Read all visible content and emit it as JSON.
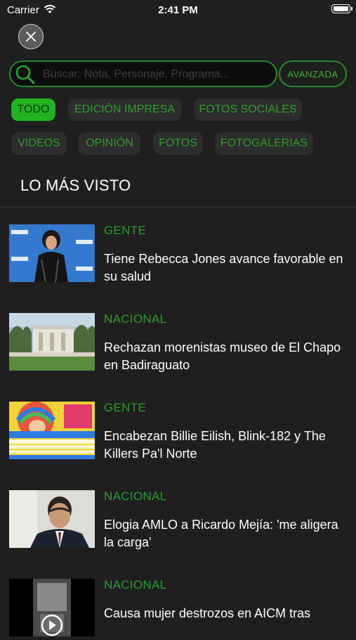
{
  "status_bar": {
    "carrier": "Carrier",
    "time": "2:41 PM"
  },
  "search": {
    "placeholder": "Buscar: Nota, Personaje, Programa...",
    "value": "",
    "advanced_label": "AVANZADA"
  },
  "filters": [
    {
      "label": "TODO",
      "active": true
    },
    {
      "label": "EDICIÓN IMPRESA",
      "active": false
    },
    {
      "label": "FOTOS SOCIALES",
      "active": false
    },
    {
      "label": "VIDEOS",
      "active": false
    },
    {
      "label": "OPINIÓN",
      "active": false
    },
    {
      "label": "FOTOS",
      "active": false
    },
    {
      "label": "FOTOGALERIAS",
      "active": false
    }
  ],
  "section_title": "LO MÁS VISTO",
  "news": [
    {
      "category": "GENTE",
      "title": "Tiene Rebecca Jones avance favorable en su salud"
    },
    {
      "category": "NACIONAL",
      "title": "Rechazan morenistas museo de El Chapo en Badiraguato"
    },
    {
      "category": "GENTE",
      "title": "Encabezan Billie Eilish, Blink-182 y The Killers Pa'l Norte"
    },
    {
      "category": "NACIONAL",
      "title": "Elogia AMLO a Ricardo Mejía: 'me aligera la carga'"
    },
    {
      "category": "NACIONAL",
      "title": "Causa mujer destrozos en AICM tras"
    }
  ],
  "colors": {
    "accent": "#22b222",
    "accent_text": "#2f9d2f",
    "background": "#1f1f1f"
  },
  "icons": [
    "wifi-icon",
    "battery-icon",
    "close-icon",
    "search-icon",
    "play-icon"
  ]
}
